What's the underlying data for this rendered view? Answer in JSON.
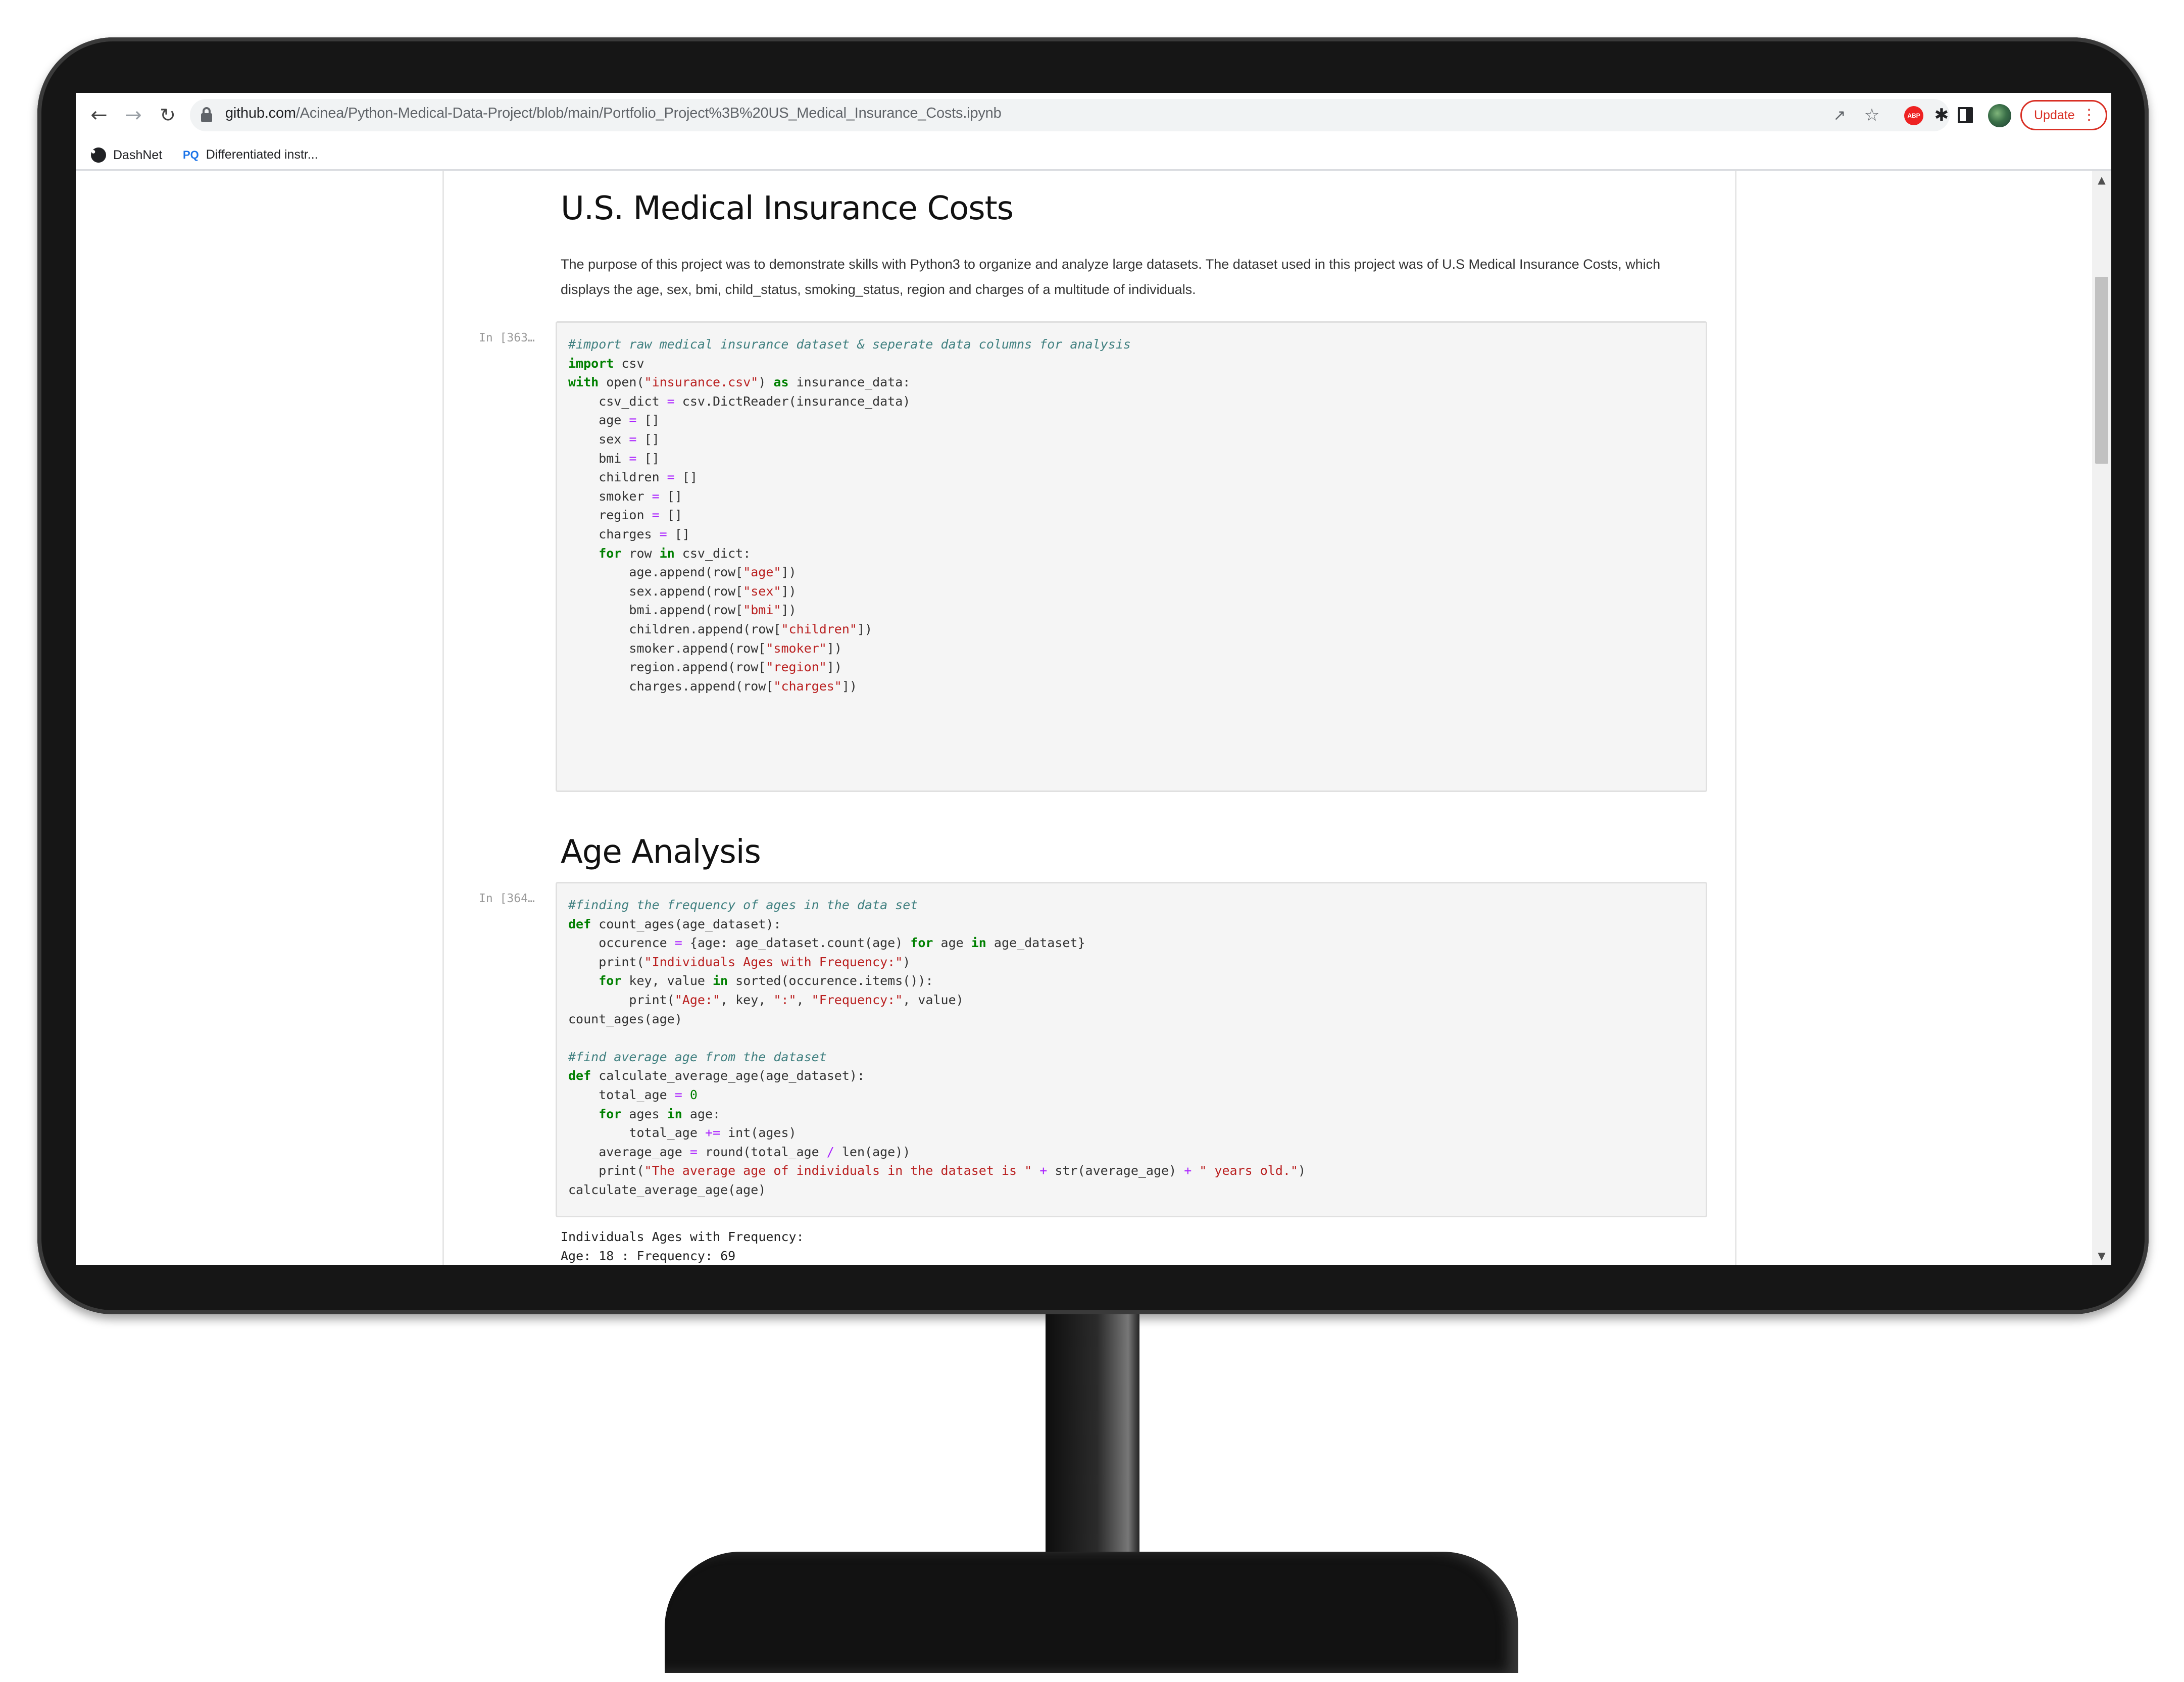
{
  "browser": {
    "url_host": "github.com",
    "url_path": "/Acinea/Python-Medical-Data-Project/blob/main/Portfolio_Project%3B%20US_Medical_Insurance_Costs.ipynb",
    "update_label": "Update",
    "abp_label": "ABP",
    "bookmarks": [
      {
        "label": "DashNet"
      },
      {
        "label": "Differentiated instr...",
        "icon_text": "PQ"
      }
    ]
  },
  "notebook": {
    "title": "U.S. Medical Insurance Costs",
    "intro": "The purpose of this project was to demonstrate skills with Python3 to organize and analyze large datasets. The dataset used in this project was of U.S Medical Insurance Costs, which displays the age, sex, bmi, child_status, smoking_status, region and charges of a multitude of individuals.",
    "section2_title": "Age Analysis",
    "cell1": {
      "prompt": "In [363…",
      "lines": [
        "#import raw medical insurance dataset & seperate data columns for analysis",
        "import csv",
        "with open(\"insurance.csv\") as insurance_data:",
        "    csv_dict = csv.DictReader(insurance_data)",
        "    age = []",
        "    sex = []",
        "    bmi = []",
        "    children = []",
        "    smoker = []",
        "    region = []",
        "    charges = []",
        "    for row in csv_dict:",
        "        age.append(row[\"age\"])",
        "        sex.append(row[\"sex\"])",
        "        bmi.append(row[\"bmi\"])",
        "        children.append(row[\"children\"])",
        "        smoker.append(row[\"smoker\"])",
        "        region.append(row[\"region\"])",
        "        charges.append(row[\"charges\"])"
      ]
    },
    "cell2": {
      "prompt": "In [364…",
      "lines": [
        "#finding the frequency of ages in the data set",
        "def count_ages(age_dataset):",
        "    occurence = {age: age_dataset.count(age) for age in age_dataset}",
        "    print(\"Individuals Ages with Frequency:\")",
        "    for key, value in sorted(occurence.items()):",
        "        print(\"Age:\", key, \":\", \"Frequency:\", value)",
        "count_ages(age)",
        "",
        "#find average age from the dataset",
        "def calculate_average_age(age_dataset):",
        "    total_age = 0",
        "    for ages in age:",
        "        total_age += int(ages)",
        "    average_age = round(total_age / len(age))",
        "    print(\"The average age of individuals in the dataset is \" + str(average_age) + \" years old.\")",
        "calculate_average_age(age)"
      ]
    },
    "output_lines": [
      "Individuals Ages with Frequency:",
      "Age: 18 : Frequency: 69"
    ]
  },
  "colors": {
    "comment": "#408080",
    "keyword": "#008000",
    "string": "#ba2121",
    "operator": "#aa22ff",
    "update_red": "#d93025"
  },
  "icons": [
    "back-arrow-icon",
    "forward-arrow-icon",
    "reload-icon",
    "lock-icon",
    "share-icon",
    "star-icon",
    "puzzle-extensions-icon",
    "side-panel-icon",
    "profile-avatar",
    "kebab-menu-icon"
  ]
}
